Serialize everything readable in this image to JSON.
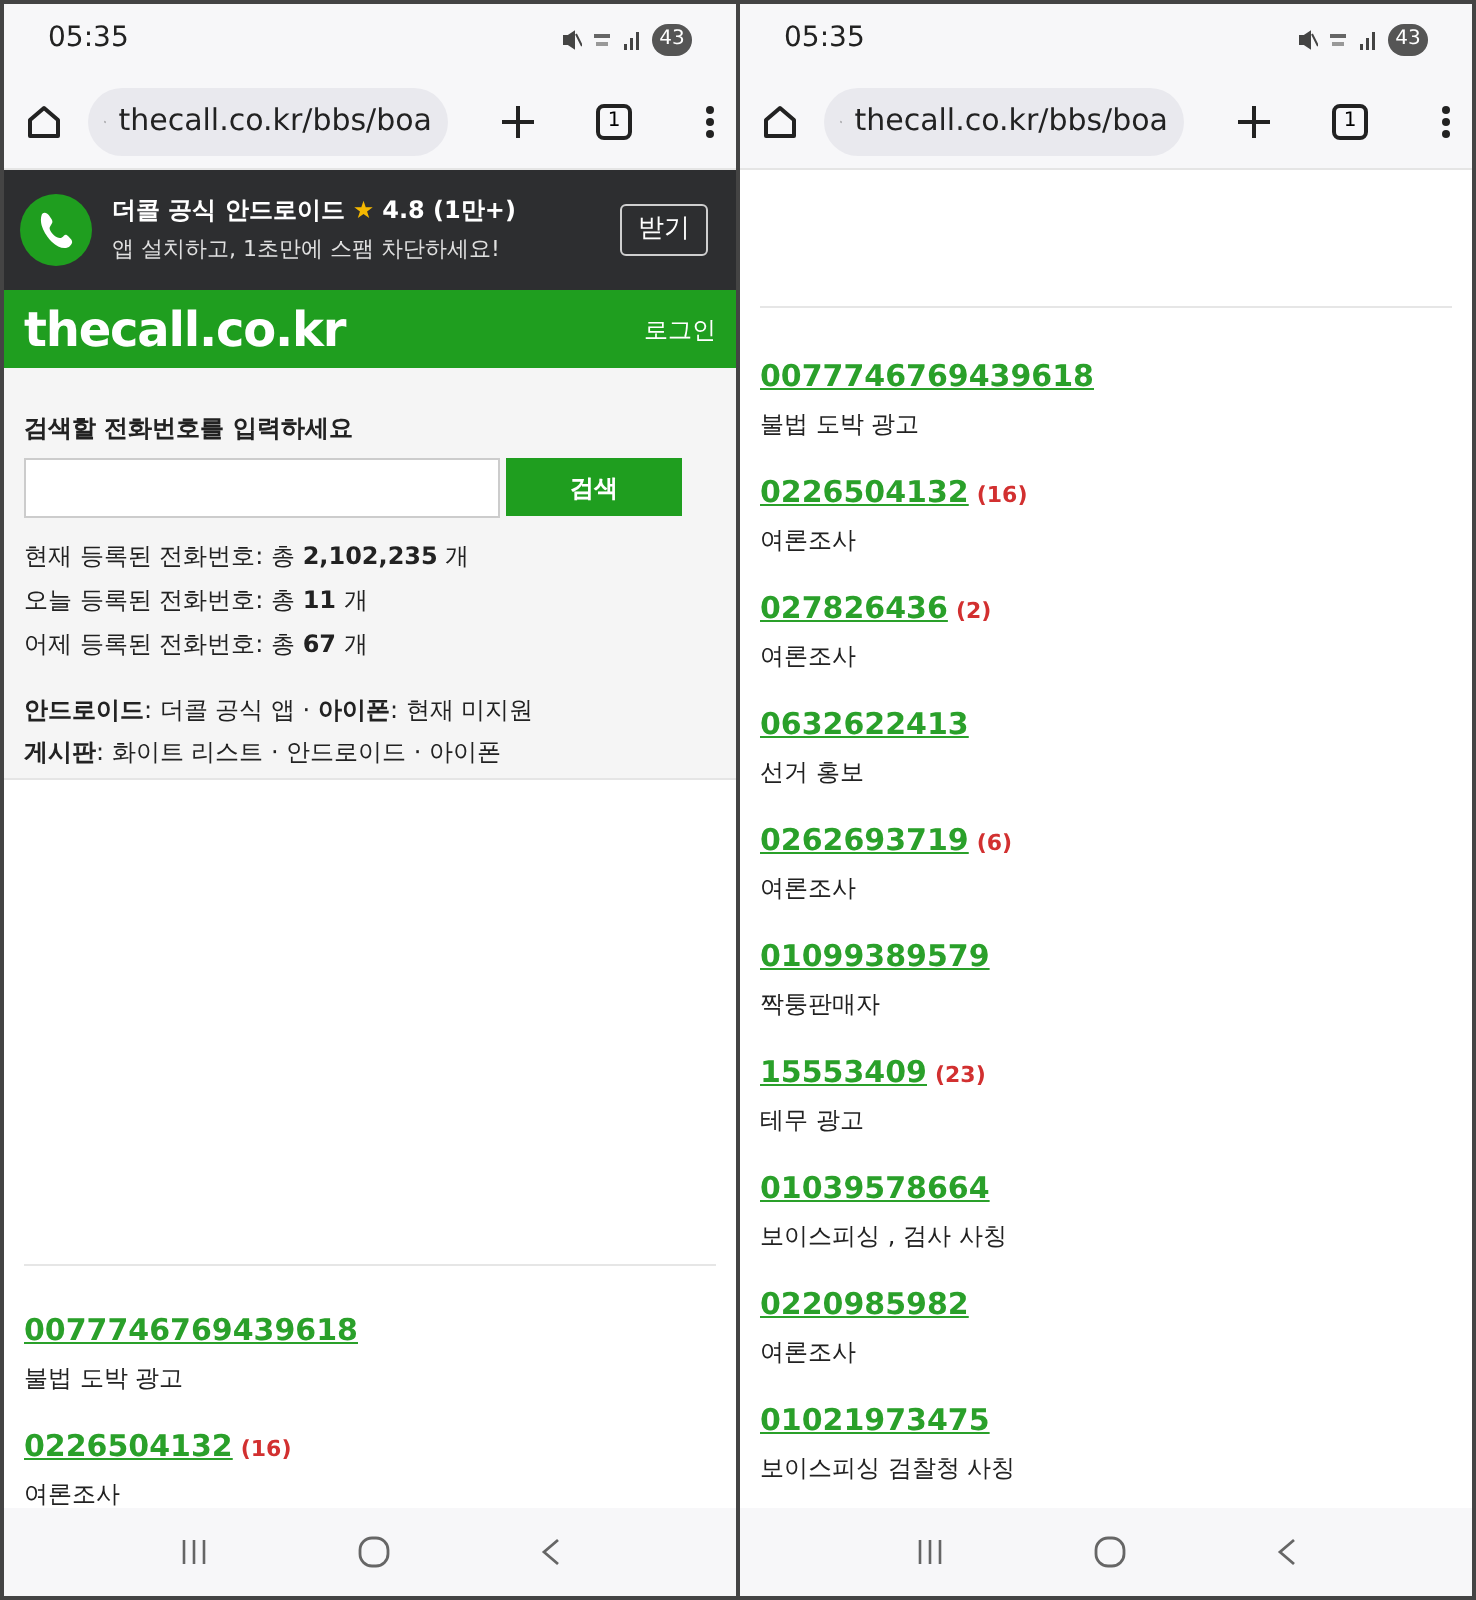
{
  "screens": [
    {
      "status_bar": {
        "time": "05:35",
        "battery": "43"
      },
      "browser": {
        "url": "thecall.co.kr/bbs/boa",
        "tab_count": "1"
      },
      "app_banner": {
        "title": "더콜 공식 안드로이드",
        "star": "★",
        "rating": "4.8 (1만+)",
        "subtitle": "앱 설치하고, 1초만에 스팸 차단하세요!",
        "button": "받기"
      },
      "site_header": {
        "logo": "thecall.co.kr",
        "login": "로그인"
      },
      "search": {
        "label": "검색할 전화번호를 입력하세요",
        "button": "검색",
        "stats": [
          "현재 등록된 전화번호: 총 **2,102,235** 개",
          "오늘 등록된 전화번호: 총 **11** 개",
          "어제 등록된 전화번호: 총 **67** 개"
        ],
        "links": [
          "**안드로이드**: 더콜 공식 앱 · **아이폰**: 현재 미지원",
          "**게시판**: 화이트 리스트 · 안드로이드 · 아이폰"
        ]
      },
      "entries": [
        {
          "number": "0077746769439618",
          "description": "불법 도박 광고"
        },
        {
          "number": "0226504132",
          "count": "(16)",
          "description": "여론조사"
        }
      ]
    },
    {
      "status_bar": {
        "time": "05:35",
        "battery": "43"
      },
      "browser": {
        "url": "thecall.co.kr/bbs/boa",
        "tab_count": "1"
      },
      "entries": [
        {
          "number": "0077746769439618",
          "description": "불법 도박 광고"
        },
        {
          "number": "0226504132",
          "count": "(16)",
          "description": "여론조사"
        },
        {
          "number": "027826436",
          "count": "(2)",
          "description": "여론조사"
        },
        {
          "number": "0632622413",
          "description": "선거 홍보"
        },
        {
          "number": "0262693719",
          "count": "(6)",
          "description": "여론조사"
        },
        {
          "number": "01099389579",
          "description": "짝퉁판매자"
        },
        {
          "number": "15553409",
          "count": "(23)",
          "description": "테무 광고"
        },
        {
          "number": "01039578664",
          "description": "보이스피싱 , 검사 사칭"
        },
        {
          "number": "0220985982",
          "description": "여론조사"
        },
        {
          "number": "01021973475",
          "description": "보이스피싱 검찰청 사칭"
        }
      ]
    }
  ]
}
